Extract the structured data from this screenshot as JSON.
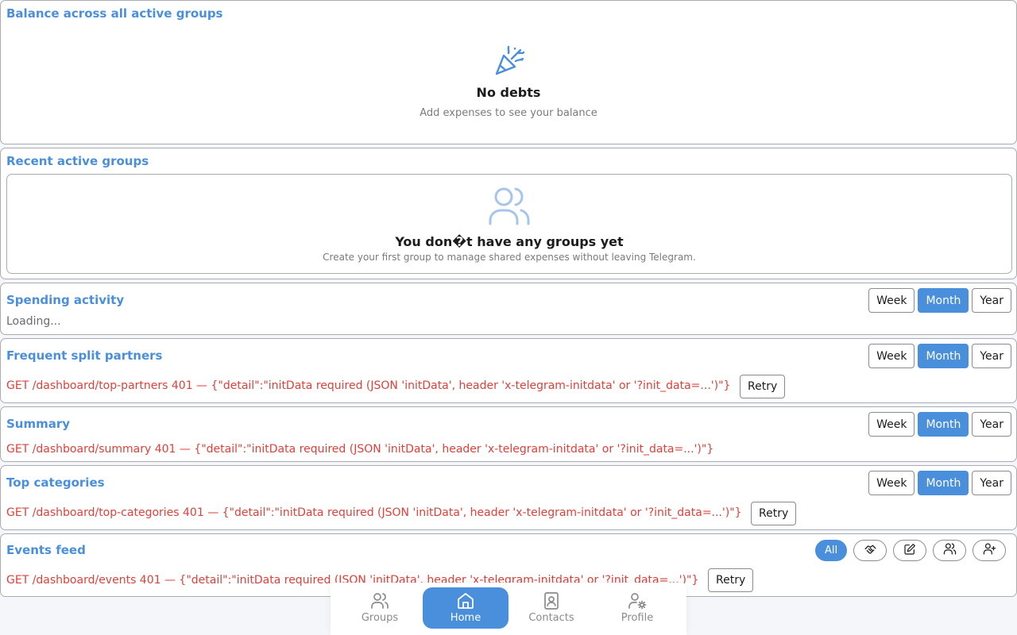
{
  "balance": {
    "title": "Balance across all active groups",
    "empty_title": "No debts",
    "empty_subtitle": "Add expenses to see your balance",
    "icon": "party-popper-icon"
  },
  "groups": {
    "title": "Recent active groups",
    "empty_title": "You don�t have any groups yet",
    "empty_subtitle": "Create your first group to manage shared expenses without leaving Telegram.",
    "icon": "users-icon"
  },
  "periods": {
    "week": "Week",
    "month": "Month",
    "year": "Year",
    "selected": "Month"
  },
  "spending": {
    "title": "Spending activity",
    "status": "Loading..."
  },
  "partners": {
    "title": "Frequent split partners",
    "error": "GET /dashboard/top-partners 401 — {\"detail\":\"initData required (JSON 'initData', header 'x-telegram-initdata' or '?init_data=...')\"}",
    "retry": "Retry"
  },
  "summary": {
    "title": "Summary",
    "error": "GET /dashboard/summary 401 — {\"detail\":\"initData required (JSON 'initData', header 'x-telegram-initdata' or '?init_data=...')\"}"
  },
  "categories": {
    "title": "Top categories",
    "error": "GET /dashboard/top-categories 401 — {\"detail\":\"initData required (JSON 'initData', header 'x-telegram-initdata' or '?init_data=...')\"}",
    "retry": "Retry"
  },
  "events": {
    "title": "Events feed",
    "filters": [
      {
        "label": "All",
        "icon": "",
        "active": true
      },
      {
        "label": "",
        "icon": "handshake-icon",
        "active": false
      },
      {
        "label": "",
        "icon": "edit-icon",
        "active": false
      },
      {
        "label": "",
        "icon": "users-icon",
        "active": false
      },
      {
        "label": "",
        "icon": "user-plus-icon",
        "active": false
      }
    ],
    "error": "GET /dashboard/events 401 — {\"detail\":\"initData required (JSON 'initData', header 'x-telegram-initdata' or '?init_data=...')\"}",
    "retry": "Retry"
  },
  "nav": {
    "items": [
      {
        "label": "Groups",
        "icon": "users-icon",
        "active": false
      },
      {
        "label": "Home",
        "icon": "home-icon",
        "active": true
      },
      {
        "label": "Contacts",
        "icon": "contact-book-icon",
        "active": false
      },
      {
        "label": "Profile",
        "icon": "user-settings-icon",
        "active": false
      }
    ]
  },
  "colors": {
    "accent": "#4a8fdc",
    "error": "#e0403a",
    "muted": "#7a7a80"
  }
}
